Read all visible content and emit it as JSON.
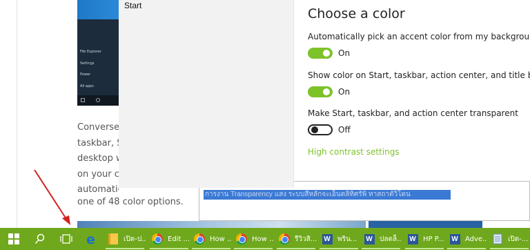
{
  "article": {
    "start_menu_items": [
      "File Explorer",
      "Settings",
      "Power",
      "All apps"
    ],
    "text_lines": [
      "Conversel",
      "taskbar, St",
      "desktop w",
      "on your ch",
      "automatically",
      "one of 48 color options."
    ],
    "editor_selected_text": "การงาน Transparency แสง ระบบสีหลักจะเอ็นตลิทิศรัพิ ทาสถาตัวิโดน"
  },
  "settings": {
    "nav_item": "Start",
    "heading": "Choose a color",
    "options": [
      {
        "label": "Automatically pick an accent color from my background",
        "state": "On",
        "on": true
      },
      {
        "label": "Show color on Start, taskbar, action center, and title bar",
        "state": "On",
        "on": true
      },
      {
        "label": "Make Start, taskbar, and action center transparent",
        "state": "Off",
        "on": false
      }
    ],
    "high_contrast_link": "High contrast settings"
  },
  "taskbar": {
    "color": "#6fa81c",
    "accent": "#7ec22a",
    "apps": [
      {
        "icon": "file-explorer-icon",
        "label": "เปิด-ป..."
      },
      {
        "icon": "chrome-icon",
        "label": "Edit ..."
      },
      {
        "icon": "chrome-icon",
        "label": "How ..."
      },
      {
        "icon": "chrome-icon",
        "label": "How ..."
      },
      {
        "icon": "chrome-icon",
        "label": "รีวิวสิ..."
      },
      {
        "icon": "word-icon",
        "label": "พริน..."
      },
      {
        "icon": "word-icon",
        "label": "ปลดล็..."
      },
      {
        "icon": "word-icon",
        "label": "HP P..."
      },
      {
        "icon": "word-icon",
        "label": "Adve..."
      },
      {
        "icon": "notepad-icon",
        "label": "เปิด-..."
      }
    ]
  }
}
